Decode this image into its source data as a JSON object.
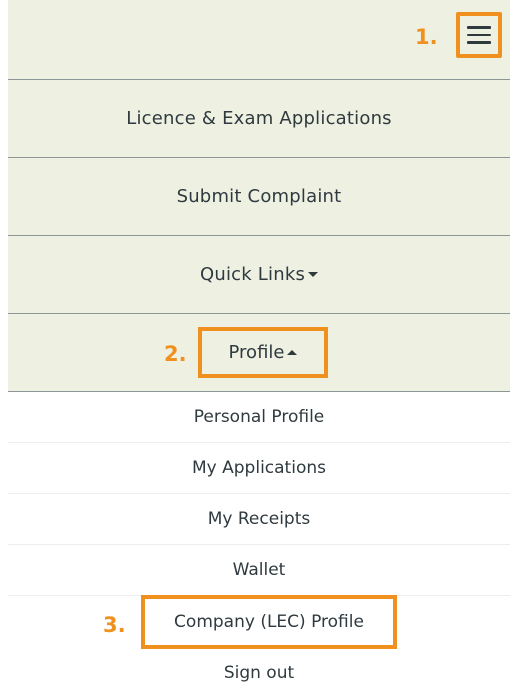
{
  "header": {
    "menu_icon": "hamburger-menu-icon"
  },
  "nav": {
    "licence_label": "Licence & Exam Applications",
    "complaint_label": "Submit Complaint",
    "quick_links_label": "Quick Links",
    "profile_label": "Profile"
  },
  "profile_menu": {
    "items": [
      "Personal Profile",
      "My Applications",
      "My Receipts",
      "Wallet",
      "Company (LEC) Profile",
      "Sign out"
    ]
  },
  "annotations": {
    "step1": "1.",
    "step2": "2.",
    "step3": "3.",
    "highlight_color": "#f0901e"
  },
  "colors": {
    "nav_background": "#eef0e2",
    "divider": "#8e9597",
    "text": "#2f3a3f"
  }
}
